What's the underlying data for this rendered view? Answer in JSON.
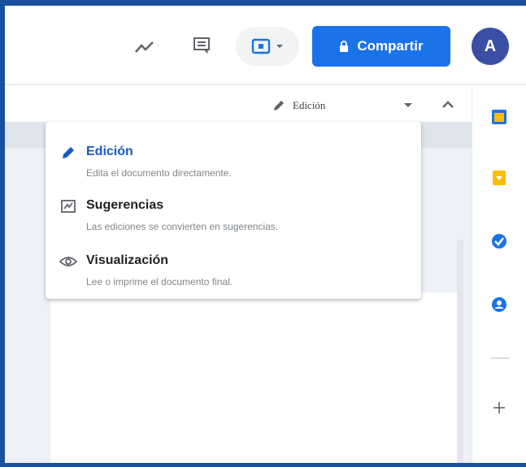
{
  "header": {
    "share_label": "Compartir",
    "avatar_initial": "A",
    "icons": [
      "trend-icon",
      "comments-icon",
      "present-icon",
      "dropdown-arrow-icon",
      "lock-icon"
    ]
  },
  "mode": {
    "current_label": "Edición"
  },
  "mode_menu": {
    "items": [
      {
        "title": "Edición",
        "description": "Edita el documento directamente.",
        "icon": "pencil-icon",
        "active": true
      },
      {
        "title": "Sugerencias",
        "description": "Las ediciones se convierten en sugerencias.",
        "icon": "suggest-icon",
        "active": false
      },
      {
        "title": "Visualización",
        "description": "Lee o imprime el documento final.",
        "icon": "eye-icon",
        "active": false
      }
    ]
  },
  "side_panel": {
    "icons": [
      "calendar-icon",
      "keep-icon",
      "tasks-icon",
      "contacts-icon",
      "add-icon"
    ]
  },
  "colors": {
    "accent": "#1a73e8",
    "frame": "#1a4f9c",
    "avatar": "#3b4ea6",
    "active_text": "#1a56c5"
  }
}
